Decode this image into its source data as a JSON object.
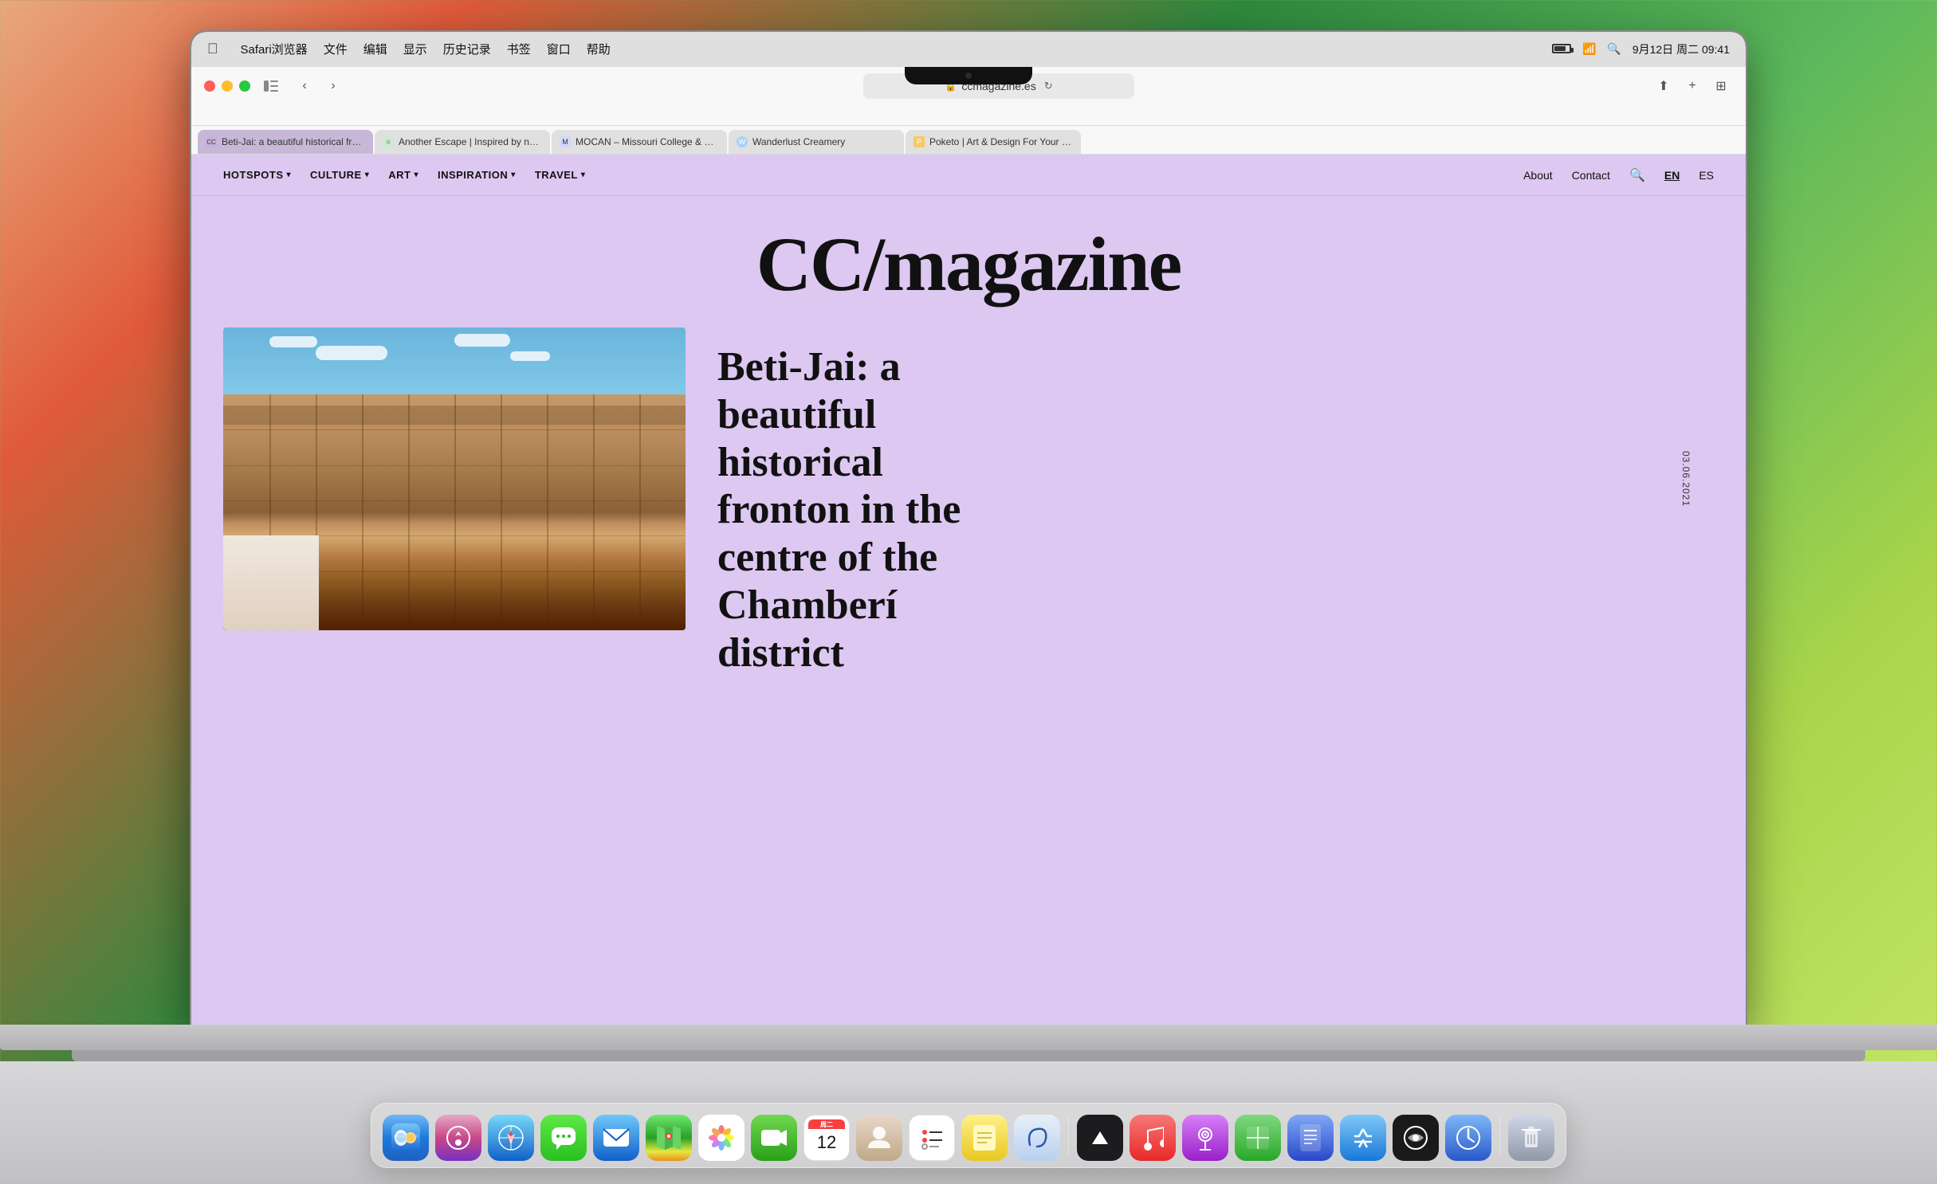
{
  "desktop": {
    "background": "macOS Sonoma gradient"
  },
  "menubar": {
    "apple": "⌘",
    "items": [
      "Safari浏览器",
      "文件",
      "编辑",
      "显示",
      "历史记录",
      "书签",
      "窗口",
      "帮助"
    ],
    "time": "9月12日 周二 09:41"
  },
  "safari": {
    "url": "ccmagazine.es",
    "tabs": [
      {
        "label": "Beti-Jai: a beautiful historical fronton in the...",
        "active": true,
        "favicon": "🟣"
      },
      {
        "label": "Another Escape | Inspired by nature",
        "active": false,
        "favicon": "○"
      },
      {
        "label": "MOCAN – Missouri College & Career Attainm...",
        "active": false,
        "favicon": "🎓"
      },
      {
        "label": "Wanderlust Creamery",
        "active": false,
        "favicon": "🔵"
      },
      {
        "label": "Poketo | Art & Design For Your Every Day",
        "active": false,
        "favicon": "🟠"
      }
    ]
  },
  "website": {
    "nav": {
      "items": [
        {
          "label": "HOTSPOTS",
          "dropdown": true
        },
        {
          "label": "CULTURE",
          "dropdown": true
        },
        {
          "label": "ART",
          "dropdown": true
        },
        {
          "label": "INSPIRATION",
          "dropdown": true
        },
        {
          "label": "TRAVEL",
          "dropdown": true
        }
      ],
      "right_items": [
        "About",
        "Contact"
      ],
      "lang_en": "EN",
      "lang_es": "ES"
    },
    "title": "CC/magazine",
    "article": {
      "title": "Beti-Jai: a beautiful historical fronton in the centre of the Chamberí district",
      "date": "03.06.2021"
    }
  },
  "dock": {
    "apps": [
      {
        "name": "Finder",
        "icon": "finder",
        "emoji": "😊"
      },
      {
        "name": "Launchpad",
        "icon": "launchpad",
        "emoji": "🚀"
      },
      {
        "name": "Safari",
        "icon": "safari",
        "emoji": "🧭"
      },
      {
        "name": "Messages",
        "icon": "messages",
        "emoji": "💬"
      },
      {
        "name": "Mail",
        "icon": "mail",
        "emoji": "✉️"
      },
      {
        "name": "Maps",
        "icon": "maps",
        "emoji": "🗺️"
      },
      {
        "name": "Photos",
        "icon": "photos",
        "emoji": "📷"
      },
      {
        "name": "FaceTime",
        "icon": "facetime",
        "emoji": "📹"
      },
      {
        "name": "Calendar",
        "icon": "calendar",
        "emoji": "12"
      },
      {
        "name": "Contacts",
        "icon": "contacts",
        "emoji": "👤"
      },
      {
        "name": "Reminders",
        "icon": "reminders",
        "emoji": "☑️"
      },
      {
        "name": "Notes",
        "icon": "notes",
        "emoji": "📝"
      },
      {
        "name": "Freeform",
        "icon": "freeform",
        "emoji": "✏️"
      },
      {
        "name": "Apple TV",
        "icon": "appletv",
        "emoji": "▶️"
      },
      {
        "name": "Music",
        "icon": "music",
        "emoji": "🎵"
      },
      {
        "name": "Podcasts",
        "icon": "podcasts",
        "emoji": "🎙️"
      },
      {
        "name": "Numbers",
        "icon": "numbers",
        "emoji": "📊"
      },
      {
        "name": "Pages",
        "icon": "pages",
        "emoji": "📄"
      },
      {
        "name": "App Store",
        "icon": "appstore",
        "emoji": "🅰️"
      },
      {
        "name": "ChatGPT",
        "icon": "chatgpt",
        "emoji": "✦"
      },
      {
        "name": "Screen Time",
        "icon": "screentime",
        "emoji": "🕐"
      },
      {
        "name": "Trash",
        "icon": "trash",
        "emoji": "🗑️"
      }
    ]
  }
}
